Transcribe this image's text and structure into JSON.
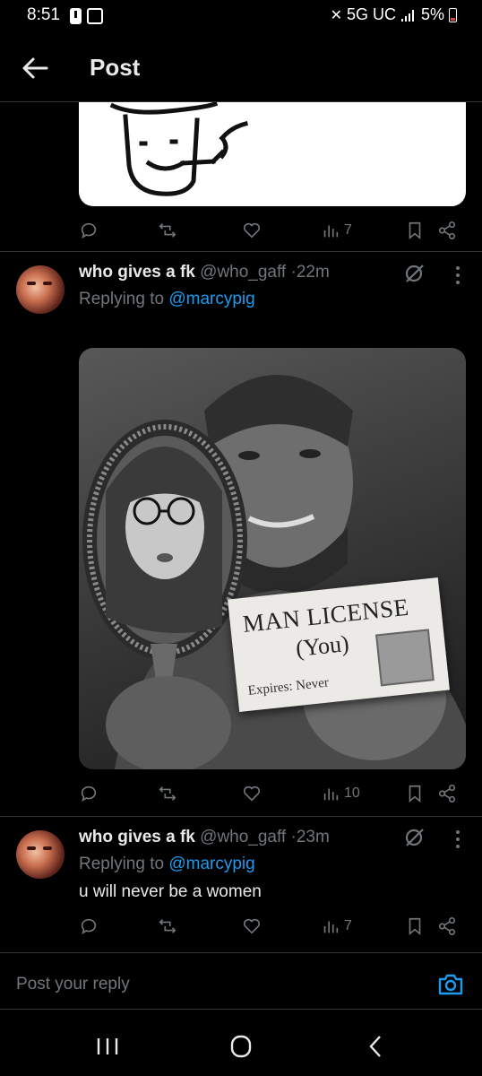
{
  "status_bar": {
    "time": "8:51",
    "network": "5G UC",
    "battery": "5%"
  },
  "header": {
    "title": "Post"
  },
  "top_post": {
    "view_count": "7"
  },
  "tweet1": {
    "name": "who gives a fk",
    "handle": "@who_gaff",
    "separator": "·",
    "time": "22m",
    "replying_prefix": "Replying to",
    "replying_to": "@marcypig",
    "image": {
      "card_title": "MAN LICENSE",
      "card_subtitle": "(You)",
      "card_expires": "Expires: Never"
    },
    "view_count": "10"
  },
  "tweet2": {
    "name": "who gives a fk",
    "handle": "@who_gaff",
    "separator": "·",
    "time": "23m",
    "replying_prefix": "Replying to",
    "replying_to": "@marcypig",
    "text": "u will never be a women",
    "view_count": "7"
  },
  "composer": {
    "placeholder": "Post your reply"
  },
  "colors": {
    "background": "#000000",
    "text": "#e7e9ea",
    "muted": "#71767b",
    "accent": "#1d9bf0",
    "divider": "#2f3336"
  }
}
